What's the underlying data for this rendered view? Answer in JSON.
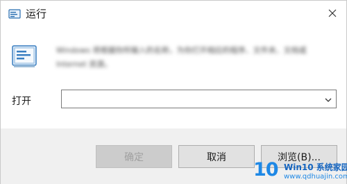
{
  "window": {
    "title": "运行",
    "icon": "run-icon",
    "close_icon": "close-icon"
  },
  "description": "Windows 将根据你所输入的名称，为你打开相应的程序、文件夹、文档或 Internet 资源。",
  "open": {
    "label": "打开",
    "value": "",
    "dropdown_icon": "chevron-down-icon"
  },
  "buttons": {
    "ok": "确定",
    "cancel": "取消",
    "browse": "浏览(B)..."
  },
  "watermark": {
    "number": "10",
    "title": "Win10 系统家园",
    "url": "www.qdhuajin.com"
  },
  "colors": {
    "footer_bg": "#f0f0f0",
    "watermark_blue": "#1e88e5"
  }
}
